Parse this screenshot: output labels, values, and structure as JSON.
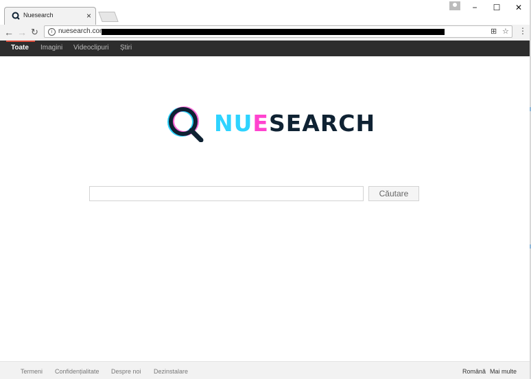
{
  "browser": {
    "tab_title": "Nuesearch",
    "tab_close": "×",
    "url": "nuesearch.com",
    "window_minimize": "−",
    "window_maximize": "☐",
    "window_close": "✕"
  },
  "nav": {
    "items": [
      "Toate",
      "Imagini",
      "Videoclipuri",
      "Știri"
    ],
    "active": "Toate"
  },
  "logo": {
    "part1": "NU",
    "part2": "E",
    "part3": "SEARCH"
  },
  "search": {
    "value": "",
    "button_label": "Căutare"
  },
  "footer": {
    "links": [
      "Termeni",
      "Confidențialitate",
      "Despre noi",
      "Dezinstalare"
    ],
    "language": "Română",
    "more": "Mai multe"
  },
  "colors": {
    "nav_bg": "#2d2d2d",
    "accent": "#dd4b39",
    "logo_cyan": "#2ed3ff",
    "logo_magenta": "#ff43cf",
    "logo_dark": "#0f2233"
  },
  "icons": {
    "back": "back-arrow-icon",
    "forward": "forward-arrow-icon",
    "reload": "reload-icon",
    "info": "info-icon",
    "translate": "translate-icon",
    "star": "bookmark-star-icon",
    "menu": "kebab-menu-icon"
  }
}
